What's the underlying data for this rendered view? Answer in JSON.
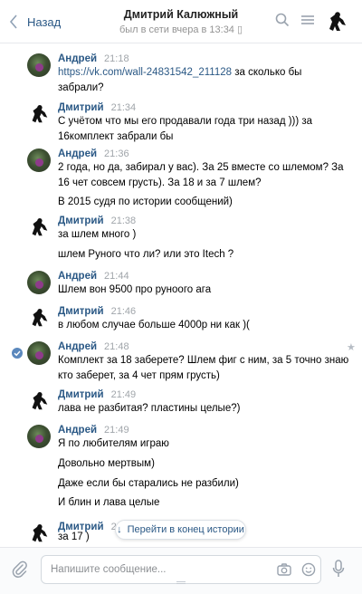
{
  "header": {
    "back_label": "Назад",
    "title": "Дмитрий Калюжный",
    "status": "был в сети вчера в 13:34"
  },
  "messages": [
    {
      "author": "Андрей",
      "time": "21:18",
      "avatar": "photo-avatar",
      "lines": [
        {
          "text": "https://vk.com/wall-24831542_211128",
          "link": true,
          "suffix": " за сколько бы"
        },
        {
          "text": "забрали?"
        }
      ]
    },
    {
      "author": "Дмитрий",
      "time": "21:34",
      "avatar": "goalie-avatar",
      "lines": [
        {
          "text": "С учётом что мы его продавали года три назад ))) за"
        },
        {
          "text": "16комплект забрали бы"
        }
      ]
    },
    {
      "author": "Андрей",
      "time": "21:36",
      "avatar": "photo-avatar",
      "lines": [
        {
          "text": "2 года, но да, забирал у вас). За 25 вместе со шлемом? За"
        },
        {
          "text": "16 чет совсем грусть). За 18 и за 7 шлем?"
        },
        {
          "text": "В 2015 судя по истории сообщений)"
        }
      ]
    },
    {
      "author": "Дмитрий",
      "time": "21:38",
      "avatar": "goalie-avatar",
      "lines": [
        {
          "text": "за шлем много )"
        },
        {
          "text": "шлем Руного что ли? или это Itech ?"
        }
      ]
    },
    {
      "author": "Андрей",
      "time": "21:44",
      "avatar": "photo-avatar",
      "lines": [
        {
          "text": "Шлем вон 9500 про руноого ага"
        }
      ]
    },
    {
      "author": "Дмитрий",
      "time": "21:46",
      "avatar": "goalie-avatar",
      "lines": [
        {
          "text": "в любом случае больше 4000р ни как )("
        }
      ]
    },
    {
      "author": "Андрей",
      "time": "21:48",
      "avatar": "photo-avatar",
      "lines": [
        {
          "text": "Комплект за 18 заберете? Шлем фиг с ним, за 5 точно знаю"
        },
        {
          "text": "кто заберет, за 4 чет прям грусть)"
        }
      ]
    },
    {
      "author": "Дмитрий",
      "time": "21:49",
      "avatar": "goalie-avatar",
      "lines": [
        {
          "text": "лава не разбитая? пластины целые?)"
        }
      ]
    },
    {
      "author": "Андрей",
      "time": "21:49",
      "avatar": "photo-avatar",
      "lines": [
        {
          "text": "Я по любителям играю"
        },
        {
          "text": "Довольно мертвым)"
        },
        {
          "text": "Даже если бы старались не разбили)"
        },
        {
          "text": "И блин и лава целые"
        }
      ]
    },
    {
      "author": "Дмитрий",
      "time": "21:5",
      "avatar": "goalie-avatar",
      "lines": [
        {
          "text": "за 17 )"
        }
      ]
    }
  ],
  "jump_label": "Перейти в конец истории",
  "composer": {
    "placeholder": "Напишите сообщение..."
  }
}
